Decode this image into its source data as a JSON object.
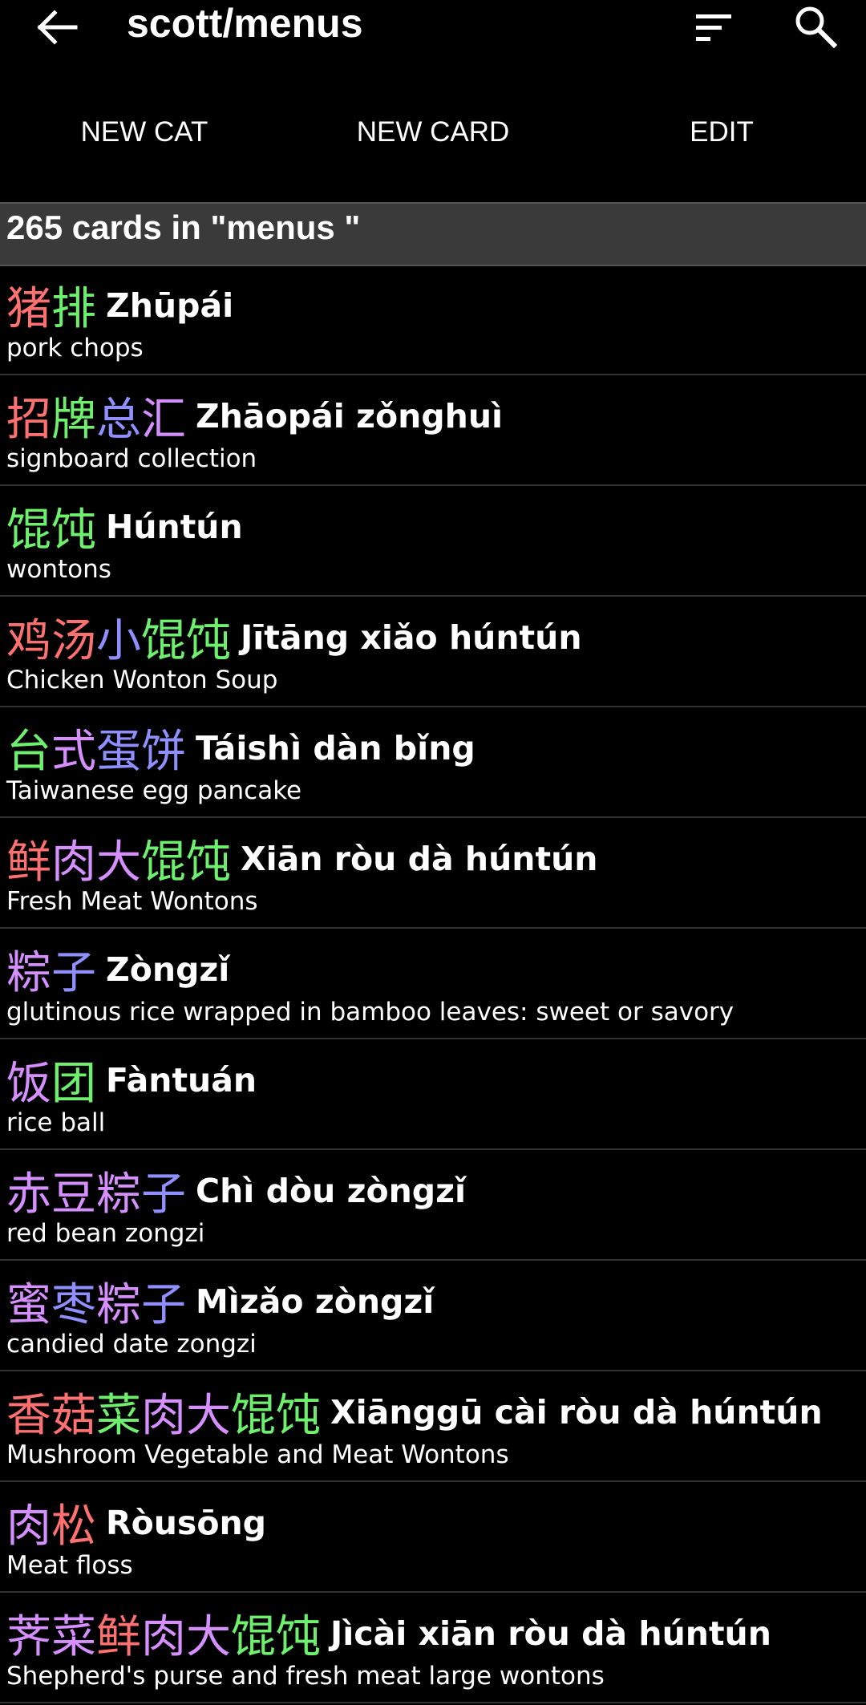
{
  "appbar": {
    "title": "scott/menus"
  },
  "actions": {
    "new_cat": "NEW CAT",
    "new_card": "NEW CARD",
    "edit": "EDIT"
  },
  "header": {
    "summary": "265 cards in \"menus   \""
  },
  "colors": {
    "red": "#ff7070",
    "green": "#6ef06e",
    "blue": "#8f8fff",
    "purple": "#d58fff"
  },
  "cards": [
    {
      "chars": [
        [
          "猪",
          "#ff7070"
        ],
        [
          "排",
          "#6ef06e"
        ]
      ],
      "pinyin": "Zhūpái",
      "english": "pork chops"
    },
    {
      "chars": [
        [
          "招",
          "#ff7070"
        ],
        [
          "牌",
          "#6ef06e"
        ],
        [
          "总",
          "#8f8fff"
        ],
        [
          "汇",
          "#d58fff"
        ]
      ],
      "pinyin": "Zhāopái zǒnghuì",
      "english": "signboard collection"
    },
    {
      "chars": [
        [
          "馄",
          "#6ef06e"
        ],
        [
          "饨",
          "#6ef06e"
        ]
      ],
      "pinyin": "Húntún",
      "english": "wontons"
    },
    {
      "chars": [
        [
          "鸡",
          "#ff7070"
        ],
        [
          "汤",
          "#ff7070"
        ],
        [
          "小",
          "#8f8fff"
        ],
        [
          "馄",
          "#6ef06e"
        ],
        [
          "饨",
          "#6ef06e"
        ]
      ],
      "pinyin": "Jītāng xiǎo húntún",
      "english": "Chicken Wonton Soup"
    },
    {
      "chars": [
        [
          "台",
          "#6ef06e"
        ],
        [
          "式",
          "#d58fff"
        ],
        [
          "蛋",
          "#8f8fff"
        ],
        [
          "饼",
          "#8f8fff"
        ]
      ],
      "pinyin": "Táishì dàn bǐng",
      "english": "Taiwanese egg pancake"
    },
    {
      "chars": [
        [
          "鲜",
          "#ff7070"
        ],
        [
          "肉",
          "#d58fff"
        ],
        [
          "大",
          "#d58fff"
        ],
        [
          "馄",
          "#6ef06e"
        ],
        [
          "饨",
          "#6ef06e"
        ]
      ],
      "pinyin": "Xiān ròu dà húntún",
      "english": "Fresh Meat Wontons"
    },
    {
      "chars": [
        [
          "粽",
          "#d58fff"
        ],
        [
          "子",
          "#8f8fff"
        ]
      ],
      "pinyin": "Zòngzǐ",
      "english": "glutinous rice wrapped in bamboo leaves: sweet or savory"
    },
    {
      "chars": [
        [
          "饭",
          "#d58fff"
        ],
        [
          "团",
          "#6ef06e"
        ]
      ],
      "pinyin": "Fàntuán",
      "english": "rice ball"
    },
    {
      "chars": [
        [
          "赤",
          "#d58fff"
        ],
        [
          "豆",
          "#d58fff"
        ],
        [
          "粽",
          "#d58fff"
        ],
        [
          "子",
          "#8f8fff"
        ]
      ],
      "pinyin": "Chì dòu zòngzǐ",
      "english": "red bean zongzi"
    },
    {
      "chars": [
        [
          "蜜",
          "#d58fff"
        ],
        [
          "枣",
          "#8f8fff"
        ],
        [
          "粽",
          "#d58fff"
        ],
        [
          "子",
          "#8f8fff"
        ]
      ],
      "pinyin": "Mìzǎo zòngzǐ",
      "english": "candied date zongzi"
    },
    {
      "chars": [
        [
          "香",
          "#ff7070"
        ],
        [
          "菇",
          "#ff7070"
        ],
        [
          "菜",
          "#6ef06e"
        ],
        [
          "肉",
          "#d58fff"
        ],
        [
          "大",
          "#d58fff"
        ],
        [
          "馄",
          "#6ef06e"
        ],
        [
          "饨",
          "#6ef06e"
        ]
      ],
      "pinyin": "Xiānggū cài ròu dà húntún",
      "english": "Mushroom Vegetable and Meat Wontons"
    },
    {
      "chars": [
        [
          "肉",
          "#d58fff"
        ],
        [
          "松",
          "#ff7070"
        ]
      ],
      "pinyin": "Ròusōng",
      "english": "Meat floss"
    },
    {
      "chars": [
        [
          "荠",
          "#d58fff"
        ],
        [
          "菜",
          "#d58fff"
        ],
        [
          "鲜",
          "#ff7070"
        ],
        [
          "肉",
          "#d58fff"
        ],
        [
          "大",
          "#d58fff"
        ],
        [
          "馄",
          "#6ef06e"
        ],
        [
          "饨",
          "#6ef06e"
        ]
      ],
      "pinyin": "Jìcài xiān ròu dà húntún",
      "english": "Shepherd's purse and fresh meat large wontons"
    }
  ]
}
